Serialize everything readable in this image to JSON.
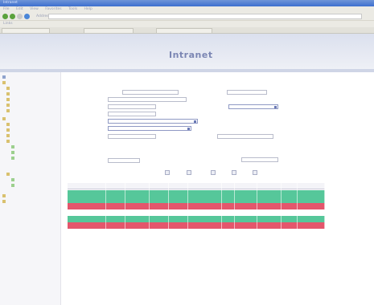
{
  "window": {
    "title": "Intranet"
  },
  "menubar": {
    "items": [
      "File",
      "Edit",
      "View",
      "Favorites",
      "Tools",
      "Help"
    ]
  },
  "toolbar": {
    "address_label": "Address",
    "address_value": ""
  },
  "links": {
    "items": [
      "Links",
      "",
      "",
      "",
      ""
    ]
  },
  "browser_tabs": [
    "",
    "",
    ""
  ],
  "banner": {
    "title": "Intranet"
  },
  "sidebar": {
    "items": [
      "",
      "",
      "",
      "",
      "",
      "",
      "",
      "",
      "",
      "",
      "",
      "",
      "",
      "",
      "",
      "",
      "",
      "",
      "",
      "",
      "",
      "",
      "",
      ""
    ]
  },
  "form": {
    "title": "",
    "link_label": "",
    "labels": [
      "",
      "",
      "",
      "",
      "",
      "",
      "",
      "",
      "",
      "",
      "",
      ""
    ],
    "values": [
      "",
      "",
      "",
      "",
      "",
      "",
      "",
      "",
      "",
      ""
    ],
    "buttons": [
      "",
      "",
      "",
      "",
      ""
    ]
  },
  "table": {
    "headers": [
      "",
      "",
      "",
      "",
      "",
      "",
      "",
      "",
      "",
      "",
      ""
    ],
    "rows": [
      {
        "status": "green",
        "cells": [
          "",
          "",
          "",
          "",
          "",
          "",
          "",
          "",
          "",
          "",
          ""
        ]
      },
      {
        "status": "green",
        "cells": [
          "",
          "",
          "",
          "",
          "",
          "",
          "",
          "",
          "",
          "",
          ""
        ]
      },
      {
        "status": "red",
        "cells": [
          "",
          "",
          "",
          "",
          "",
          "",
          "",
          "",
          "",
          "",
          ""
        ]
      },
      {
        "status": "white",
        "cells": [
          "",
          "",
          "",
          "",
          "",
          "",
          "",
          "",
          "",
          "",
          ""
        ]
      },
      {
        "status": "green",
        "cells": [
          "",
          "",
          "",
          "",
          "",
          "",
          "",
          "",
          "",
          "",
          ""
        ]
      },
      {
        "status": "red",
        "cells": [
          "",
          "",
          "",
          "",
          "",
          "",
          "",
          "",
          "",
          "",
          ""
        ]
      }
    ]
  },
  "colors": {
    "green_row": "#56c79a",
    "red_row": "#e4566c",
    "banner_title": "#7b86b3"
  }
}
